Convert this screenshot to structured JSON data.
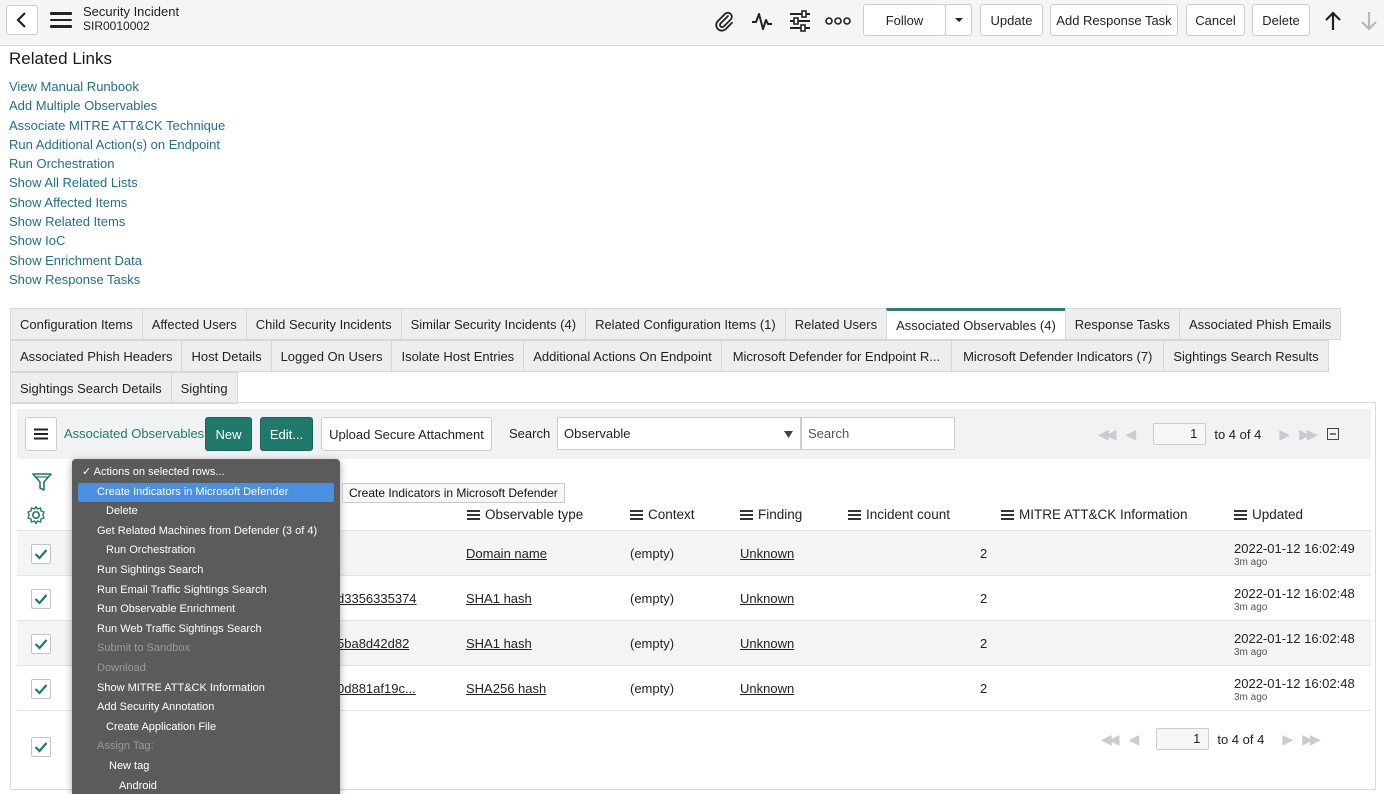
{
  "header": {
    "title": "Security Incident",
    "number": "SIR0010002",
    "buttons": {
      "follow": "Follow",
      "update": "Update",
      "add_response_task": "Add Response Task",
      "cancel": "Cancel",
      "delete": "Delete"
    }
  },
  "related_links": {
    "title": "Related Links",
    "items": [
      "View Manual Runbook",
      "Add Multiple Observables",
      "Associate MITRE ATT&CK Technique",
      "Run Additional Action(s) on Endpoint",
      "Run Orchestration",
      "Show All Related Lists",
      "Show Affected Items",
      "Show Related Items",
      "Show IoC",
      "Show Enrichment Data",
      "Show Response Tasks"
    ]
  },
  "tabs": {
    "row1": [
      "Configuration Items",
      "Affected Users",
      "Child Security Incidents",
      "Similar Security Incidents (4)",
      "Related Configuration Items (1)",
      "Related Users",
      "Associated Observables (4)",
      "Response Tasks",
      "Associated Phish Emails"
    ],
    "row2": [
      "Associated Phish Headers",
      "Host Details",
      "Logged On Users",
      "Isolate Host Entries",
      "Additional Actions On Endpoint",
      "Microsoft Defender for Endpoint R...",
      "Microsoft Defender Indicators (7)",
      "Sightings Search Results"
    ],
    "row3": [
      "Sightings Search Details",
      "Sighting"
    ],
    "active": "Associated Observables (4)"
  },
  "list": {
    "title": "Associated Observables",
    "new_label": "New",
    "edit_label": "Edit...",
    "upload_label": "Upload Secure Attachment",
    "search_label": "Search",
    "search_field": "Observable",
    "search_placeholder": "Search",
    "pager": {
      "page": "1",
      "range": "to 4 of 4"
    },
    "columns": [
      "Observable type",
      "Context",
      "Finding",
      "Incident count",
      "MITRE ATT&CK Information",
      "Updated"
    ],
    "rows": [
      {
        "observable": "",
        "type": "Domain name",
        "context": "(empty)",
        "finding": "Unknown",
        "count": "2",
        "updated": "2022-01-12 16:02:49",
        "ago": "3m ago"
      },
      {
        "observable": "d3356335374",
        "type": "SHA1 hash",
        "context": "(empty)",
        "finding": "Unknown",
        "count": "2",
        "updated": "2022-01-12 16:02:48",
        "ago": "3m ago"
      },
      {
        "observable": "5ba8d42d82",
        "type": "SHA1 hash",
        "context": "(empty)",
        "finding": "Unknown",
        "count": "2",
        "updated": "2022-01-12 16:02:48",
        "ago": "3m ago"
      },
      {
        "observable": "0d881af19c...",
        "type": "SHA256 hash",
        "context": "(empty)",
        "finding": "Unknown",
        "count": "2",
        "updated": "2022-01-12 16:02:48",
        "ago": "3m ago"
      }
    ]
  },
  "actions_menu": {
    "items": [
      {
        "label": "✓ Actions on selected rows...",
        "indent": 0,
        "state": "normal"
      },
      {
        "label": "Create Indicators in Microsoft Defender",
        "indent": 1,
        "state": "highlight"
      },
      {
        "label": "Delete",
        "indent": 2,
        "state": "normal"
      },
      {
        "label": "Get Related Machines from Defender (3 of 4)",
        "indent": 1,
        "state": "normal"
      },
      {
        "label": "Run Orchestration",
        "indent": 2,
        "state": "normal"
      },
      {
        "label": "Run Sightings Search",
        "indent": 1,
        "state": "normal"
      },
      {
        "label": "Run Email Traffic Sightings Search",
        "indent": 1,
        "state": "normal"
      },
      {
        "label": "Run Observable Enrichment",
        "indent": 1,
        "state": "normal"
      },
      {
        "label": "Run Web Traffic Sightings Search",
        "indent": 1,
        "state": "normal"
      },
      {
        "label": "Submit to Sandbox",
        "indent": 1,
        "state": "disabled"
      },
      {
        "label": "Download",
        "indent": 1,
        "state": "disabled"
      },
      {
        "label": "Show MITRE ATT&CK Information",
        "indent": 1,
        "state": "normal"
      },
      {
        "label": "Add Security Annotation",
        "indent": 1,
        "state": "normal"
      },
      {
        "label": "Create Application File",
        "indent": 2,
        "state": "normal"
      },
      {
        "label": "Assign Tag:",
        "indent": 1,
        "state": "disabled"
      },
      {
        "label": "New tag",
        "indent": 3,
        "state": "normal"
      },
      {
        "label": "Android",
        "indent": 4,
        "state": "normal"
      }
    ],
    "tooltip": "Create Indicators in Microsoft Defender"
  },
  "colors": {
    "accent": "#1f7a6b",
    "link": "#1f6f8b",
    "menu_bg": "#5b5b5b",
    "menu_highlight": "#4a90e2"
  }
}
